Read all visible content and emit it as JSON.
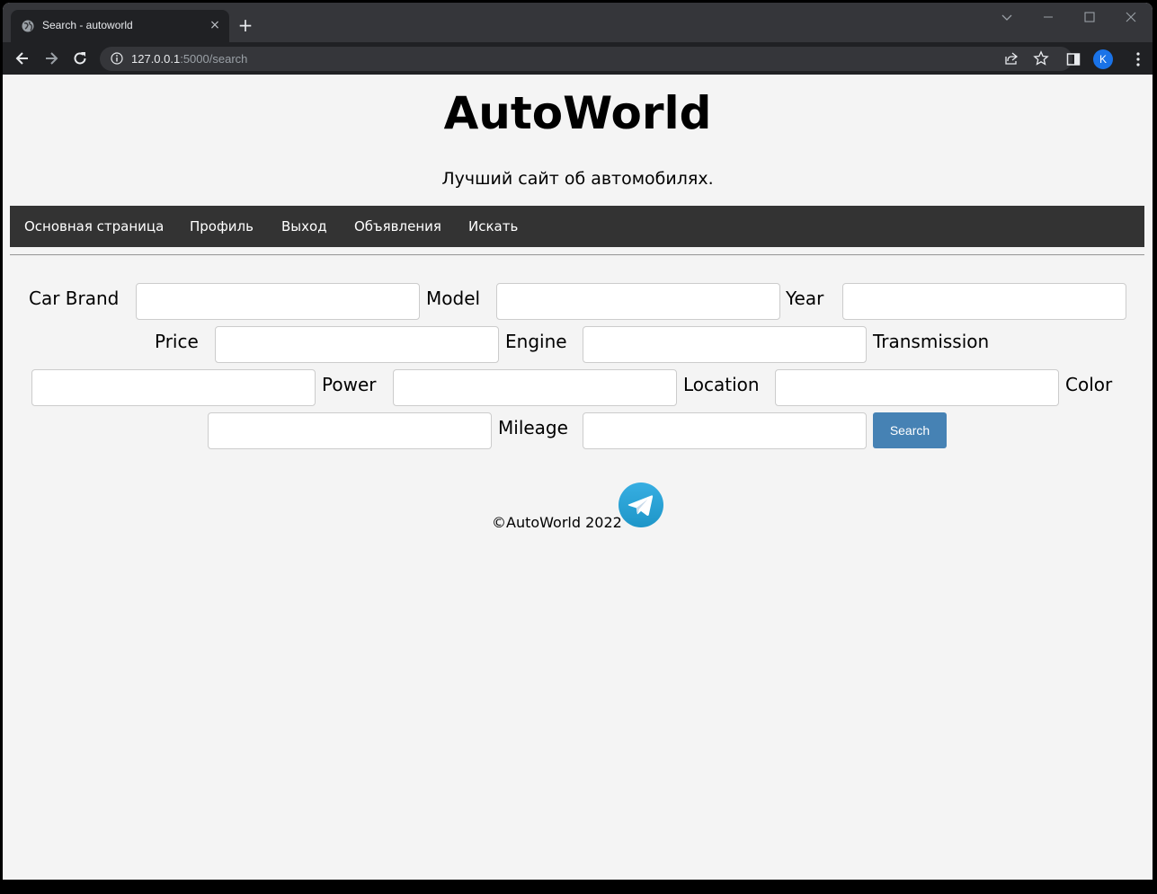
{
  "browser": {
    "tab_title": "Search - autoworld",
    "url_host": "127.0.0.1",
    "url_path": ":5000/search",
    "profile_initial": "K",
    "tab_close_glyph": "×",
    "new_tab_glyph": "+"
  },
  "site": {
    "title": "AutoWorld",
    "subtitle": "Лучший сайт об автомобилях."
  },
  "nav": {
    "items": [
      {
        "label": "Основная страница"
      },
      {
        "label": "Профиль"
      },
      {
        "label": "Выход"
      },
      {
        "label": "Объявления"
      },
      {
        "label": "Искать"
      }
    ]
  },
  "search_form": {
    "fields": [
      {
        "label": "Car Brand",
        "value": ""
      },
      {
        "label": "Model",
        "value": ""
      },
      {
        "label": "Year",
        "value": ""
      },
      {
        "label": "Price",
        "value": ""
      },
      {
        "label": "Engine",
        "value": ""
      },
      {
        "label": "Transmission",
        "value": ""
      },
      {
        "label": "Power",
        "value": ""
      },
      {
        "label": "Location",
        "value": ""
      },
      {
        "label": "Color",
        "value": ""
      },
      {
        "label": "Mileage",
        "value": ""
      }
    ],
    "submit_label": "Search"
  },
  "footer": {
    "copyright": "©AutoWorld 2022",
    "social_icon": "telegram-icon"
  },
  "colors": {
    "navbar_bg": "#333333",
    "button_bg": "#4682b4",
    "page_bg": "#f4f4f4",
    "telegram": "#2aa3e0"
  }
}
